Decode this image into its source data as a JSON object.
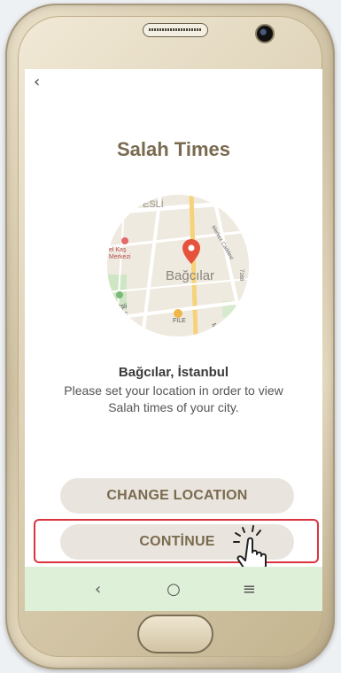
{
  "screen": {
    "back_icon": "‹",
    "title": "Salah Times",
    "map": {
      "district_label": "Bağcılar",
      "labels": [
        "ESLİ",
        "el Kaş",
        "Merkezi",
        "Merkez Caddesi",
        "Bağcılar",
        "eneşli",
        "danc",
        "FİLE",
        "ta",
        "Mah",
        "7168"
      ]
    },
    "location_name": "Bağcılar, İstanbul",
    "description": "Please set your location in order to view Salah times of your city.",
    "buttons": {
      "change_location": "CHANGE LOCATION",
      "continue": "CONTİNUE"
    },
    "navbar": {
      "back": "‹",
      "home": "○",
      "menu": "≡"
    }
  },
  "colors": {
    "title": "#7a6a4f",
    "button_bg": "#e9e5de",
    "navbar_bg": "#dff0d8",
    "highlight": "#d9343e",
    "pin": "#e5533d"
  }
}
